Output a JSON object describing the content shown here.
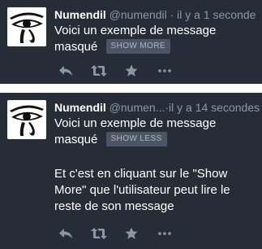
{
  "tweets": [
    {
      "name": "Numendil",
      "handle": "@numendil",
      "separator": "·",
      "time": "il y a 1 seconde",
      "text": "Voici un exemple de message masqué",
      "toggle_label": "SHOW MORE",
      "expanded_text": "",
      "actions": [
        "reply-icon",
        "retweet-icon",
        "favorite-icon",
        "more-icon"
      ]
    },
    {
      "name": "Numendil",
      "handle": "@numen...",
      "separator": "·",
      "time": "il y a 14 secondes",
      "text": "Voici un exemple de message masqué",
      "toggle_label": "SHOW LESS",
      "expanded_text": "Et c'est en cliquant sur le \"Show More\" que l'utilisateur peut lire le reste de son message",
      "actions": [
        "reply-icon",
        "retweet-icon",
        "favorite-icon",
        "more-icon"
      ]
    }
  ],
  "colors": {
    "background": "#272d36",
    "text": "#ffffff",
    "muted": "#8899a6",
    "button_bg": "#4b5564",
    "button_text": "#aab8c2"
  }
}
